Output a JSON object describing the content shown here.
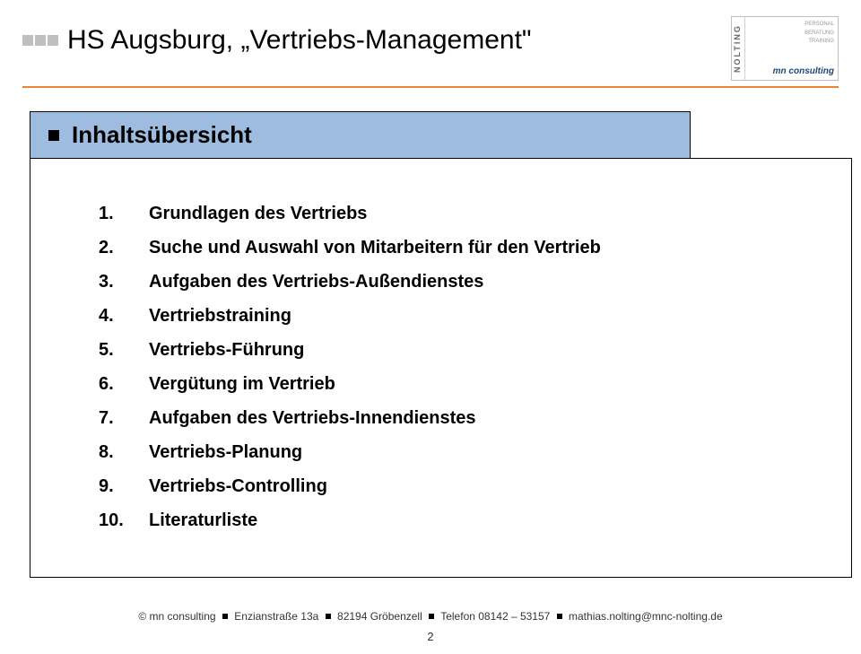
{
  "header": {
    "title": "HS Augsburg, „Vertriebs-Management\""
  },
  "logo": {
    "brand_vertical": "NOLTING",
    "service1": "PERSONAL",
    "service2": "BERATUNG",
    "service3": "TRAINING",
    "brand": "mn consulting"
  },
  "section": {
    "title": "Inhaltsübersicht"
  },
  "toc": {
    "items": [
      "Grundlagen des Vertriebs",
      "Suche und Auswahl von Mitarbeitern für den Vertrieb",
      "Aufgaben des Vertriebs-Außendienstes",
      "Vertriebstraining",
      "Vertriebs-Führung",
      "Vergütung im Vertrieb",
      "Aufgaben des Vertriebs-Innendienstes",
      "Vertriebs-Planung",
      "Vertriebs-Controlling",
      "Literaturliste"
    ]
  },
  "footer": {
    "copyright": "© mn consulting",
    "address": "Enzianstraße 13a",
    "city": "82194 Gröbenzell",
    "phone": "Telefon 08142 – 53157",
    "email": "mathias.nolting@mnc-nolting.de",
    "page": "2"
  }
}
